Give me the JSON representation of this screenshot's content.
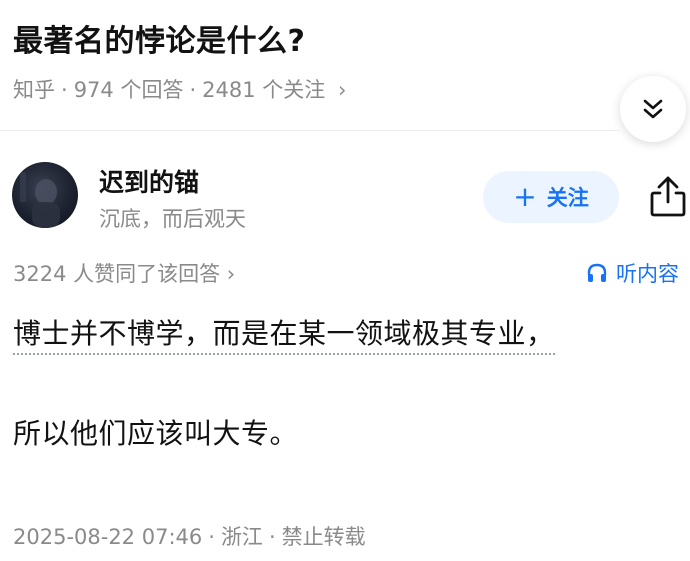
{
  "question": {
    "title": "最著名的悖论是什么?",
    "source": "知乎",
    "answer_count": "974 个回答",
    "follower_count": "2481 个关注",
    "meta_chevron": "›"
  },
  "author": {
    "name": "迟到的锚",
    "bio": "沉底，而后观天",
    "follow_label": "关注",
    "follow_plus": "+"
  },
  "answer": {
    "upvotes": "3224 人赞同了该回答 ›",
    "listen_label": "听内容",
    "paragraphs": [
      "博士并不博学，而是在某一领域极其专业，",
      "所以他们应该叫大专。"
    ],
    "date": "2025-08-22 07:46",
    "location": "浙江",
    "copyright": "禁止转载"
  },
  "colors": {
    "accent": "#1772f6",
    "follow_bg": "#ebf4ff",
    "muted_text": "#8a8a8a",
    "main_text": "#121212"
  },
  "icons": [
    "double-chevron-down-icon",
    "share-icon",
    "headphones-icon",
    "plus-icon"
  ]
}
